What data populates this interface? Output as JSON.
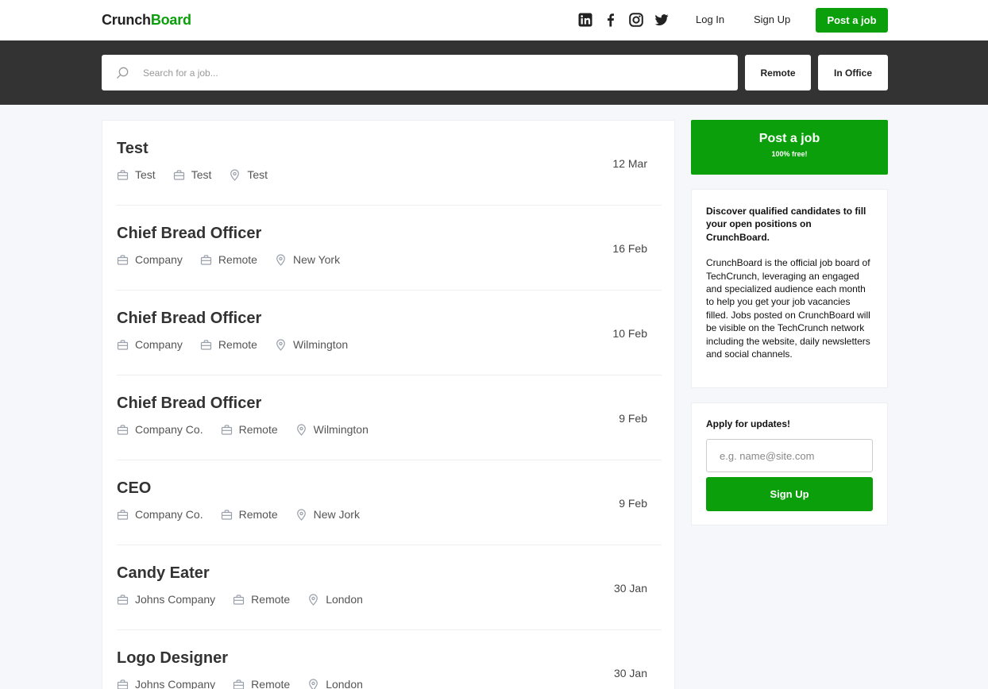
{
  "brand": {
    "part1": "Crunch",
    "part2": "Board",
    "accent_color": "#0ba00b"
  },
  "nav": {
    "social": [
      "linkedin-icon",
      "facebook-icon",
      "instagram-icon",
      "twitter-icon"
    ],
    "login": "Log In",
    "signup": "Sign Up",
    "post_job": "Post a job"
  },
  "search": {
    "placeholder": "Search for a job...",
    "filter_remote": "Remote",
    "filter_office": "In Office"
  },
  "jobs": [
    {
      "title": "Test",
      "company": "Test",
      "type": "Test",
      "location": "Test",
      "date": "12 Mar"
    },
    {
      "title": "Chief Bread Officer",
      "company": "Company",
      "type": "Remote",
      "location": "New York",
      "date": "16 Feb"
    },
    {
      "title": "Chief Bread Officer",
      "company": "Company",
      "type": "Remote",
      "location": "Wilmington",
      "date": "10 Feb"
    },
    {
      "title": "Chief Bread Officer",
      "company": "Company Co.",
      "type": "Remote",
      "location": "Wilmington",
      "date": "9 Feb"
    },
    {
      "title": "CEO",
      "company": "Company Co.",
      "type": "Remote",
      "location": "New Jork",
      "date": "9 Feb"
    },
    {
      "title": "Candy Eater",
      "company": "Johns Company",
      "type": "Remote",
      "location": "London",
      "date": "30 Jan"
    },
    {
      "title": "Logo Designer",
      "company": "Johns Company",
      "type": "Remote",
      "location": "London",
      "date": "30 Jan"
    }
  ],
  "sidebar": {
    "post": {
      "title": "Post a job",
      "subtitle": "100% free!"
    },
    "info": {
      "headline": "Discover qualified candidates to fill your open positions on CrunchBoard.",
      "body": "CrunchBoard is the official job board of TechCrunch, leveraging an engaged and specialized audience each month to help you get your job vacancies filled. Jobs posted on CrunchBoard will be visible on the TechCrunch network including the website, daily newsletters and social channels."
    },
    "updates": {
      "title": "Apply for updates!",
      "email_placeholder": "e.g. name@site.com",
      "button": "Sign Up"
    }
  }
}
